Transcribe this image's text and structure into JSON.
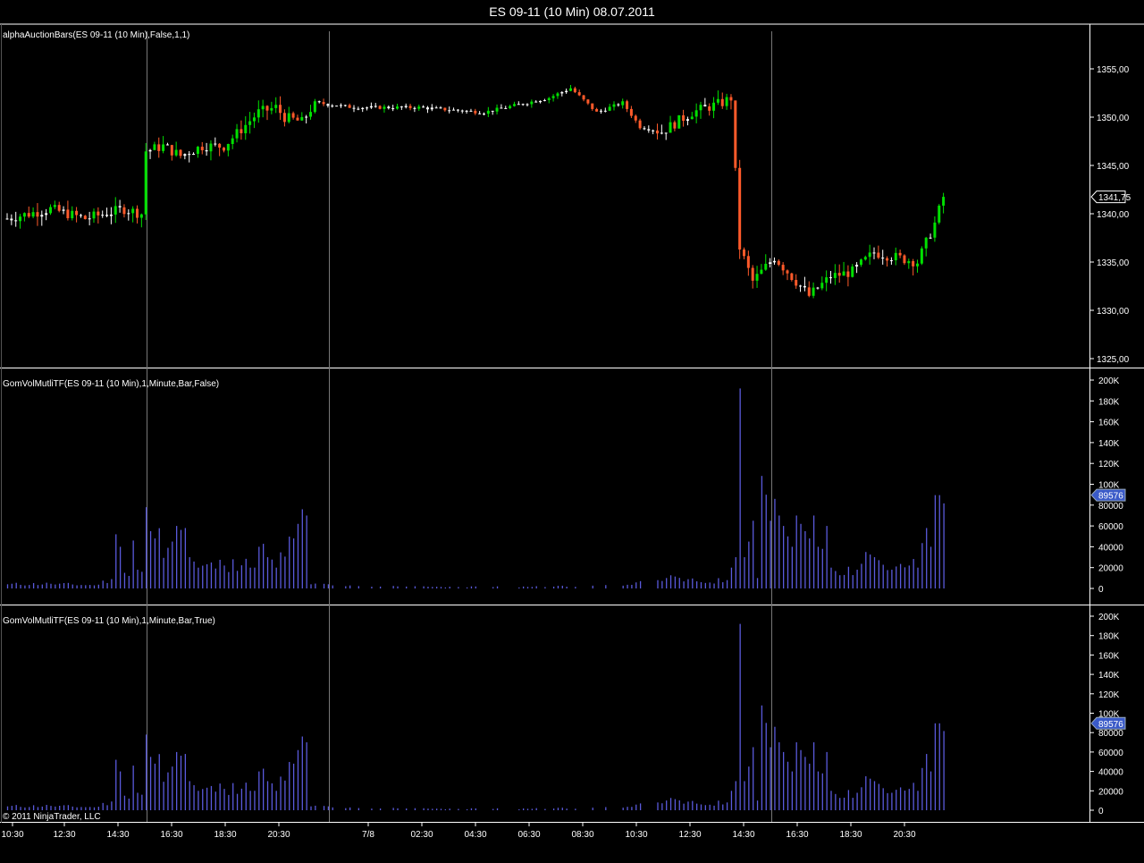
{
  "window": {
    "title": "ES 09-11 (10 Min)  08.07.2011"
  },
  "copyright": "© 2011 NinjaTrader, LLC",
  "colors": {
    "background": "#000000",
    "up_candle": "#00e000",
    "down_candle": "#ff5a2a",
    "volume_bar": "#5a5adc",
    "separator": "#ffffff",
    "session_line": "#777777",
    "price_badge": "#000000",
    "volume_badge": "#3a5ac8"
  },
  "chart_data": [
    {
      "type": "candlestick",
      "label": "alphaAuctionBars(ES 09-11 (10 Min),False,1,1)",
      "y_ticks": [
        "1325,00",
        "1330,00",
        "1335,00",
        "1340,00",
        "1345,00",
        "1350,00",
        "1355,00"
      ],
      "ylim": [
        1324,
        1359
      ],
      "last_price_label": "1341,75",
      "close_path": [
        [
          0,
          1339.5
        ],
        [
          10,
          1340.5
        ],
        [
          18,
          1339.5
        ],
        [
          27,
          1340.5
        ],
        [
          31,
          1340.0
        ],
        [
          32,
          1346.5
        ],
        [
          36,
          1347.0
        ],
        [
          40,
          1346.0
        ],
        [
          45,
          1347.0
        ],
        [
          50,
          1347.0
        ],
        [
          58,
          1350.5
        ],
        [
          62,
          1351.0
        ],
        [
          64,
          1350.0
        ],
        [
          68,
          1349.5
        ],
        [
          71,
          1351.5
        ],
        [
          80,
          1351.0
        ],
        [
          95,
          1351.0
        ],
        [
          110,
          1350.5
        ],
        [
          125,
          1352.0
        ],
        [
          130,
          1353.0
        ],
        [
          136,
          1350.5
        ],
        [
          142,
          1351.5
        ],
        [
          146,
          1349.0
        ],
        [
          151,
          1348.5
        ],
        [
          158,
          1350.5
        ],
        [
          165,
          1351.5
        ],
        [
          167,
          1352.0
        ],
        [
          169,
          1336.5
        ],
        [
          172,
          1333.0
        ],
        [
          177,
          1335.5
        ],
        [
          185,
          1331.5
        ],
        [
          190,
          1333.5
        ],
        [
          195,
          1334.0
        ],
        [
          200,
          1336.0
        ],
        [
          210,
          1335.0
        ],
        [
          214,
          1339.0
        ],
        [
          216,
          1341.75
        ]
      ]
    },
    {
      "type": "bar",
      "label": "GomVolMutliTF(ES 09-11 (10 Min),1,Minute,Bar,False)",
      "y_ticks": [
        "0",
        "20000",
        "40000",
        "60000",
        "80000",
        "100K",
        "120K",
        "140K",
        "160K",
        "180K",
        "200K"
      ],
      "ylim": [
        0,
        200000
      ],
      "last_value_label": "89576"
    },
    {
      "type": "bar",
      "label": "GomVolMutliTF(ES 09-11 (10 Min),1,Minute,Bar,True)",
      "y_ticks": [
        "0",
        "20000",
        "40000",
        "60000",
        "80000",
        "100K",
        "120K",
        "140K",
        "160K",
        "180K",
        "200K"
      ],
      "ylim": [
        0,
        200000
      ],
      "last_value_label": "89576"
    }
  ],
  "volume_series": [
    [
      0,
      4000
    ],
    [
      10,
      4500
    ],
    [
      20,
      3000
    ],
    [
      24,
      9000
    ],
    [
      25,
      52000
    ],
    [
      26,
      40000
    ],
    [
      27,
      15000
    ],
    [
      28,
      12000
    ],
    [
      29,
      46000
    ],
    [
      30,
      18000
    ],
    [
      31,
      16000
    ],
    [
      32,
      78000
    ],
    [
      33,
      55000
    ],
    [
      34,
      48000
    ],
    [
      38,
      45000
    ],
    [
      39,
      60000
    ],
    [
      41,
      58000
    ],
    [
      42,
      30000
    ],
    [
      44,
      20000
    ],
    [
      50,
      22000
    ],
    [
      52,
      28000
    ],
    [
      56,
      20000
    ],
    [
      58,
      40000
    ],
    [
      60,
      30000
    ],
    [
      62,
      20000
    ],
    [
      66,
      48000
    ],
    [
      67,
      62000
    ],
    [
      68,
      76000
    ],
    [
      69,
      70000
    ],
    [
      70,
      4000
    ],
    [
      80,
      2000
    ],
    [
      100,
      1500
    ],
    [
      120,
      1500
    ],
    [
      140,
      3000
    ],
    [
      150,
      8000
    ],
    [
      152,
      10000
    ],
    [
      160,
      6000
    ],
    [
      166,
      8000
    ],
    [
      167,
      20000
    ],
    [
      168,
      30000
    ],
    [
      169,
      192000
    ],
    [
      170,
      30000
    ],
    [
      171,
      45000
    ],
    [
      172,
      65000
    ],
    [
      173,
      10000
    ],
    [
      174,
      108000
    ],
    [
      175,
      90000
    ],
    [
      176,
      65000
    ],
    [
      177,
      86000
    ],
    [
      178,
      70000
    ],
    [
      179,
      60000
    ],
    [
      180,
      50000
    ],
    [
      181,
      40000
    ],
    [
      182,
      70000
    ],
    [
      183,
      62000
    ],
    [
      184,
      55000
    ],
    [
      185,
      48000
    ],
    [
      186,
      70000
    ],
    [
      187,
      40000
    ],
    [
      188,
      38000
    ],
    [
      189,
      60000
    ],
    [
      190,
      20000
    ],
    [
      196,
      18000
    ],
    [
      198,
      35000
    ],
    [
      200,
      30000
    ],
    [
      204,
      18000
    ],
    [
      208,
      22000
    ],
    [
      210,
      20000
    ],
    [
      212,
      58000
    ],
    [
      213,
      40000
    ],
    [
      214,
      89576
    ],
    [
      215,
      89576
    ]
  ],
  "x_axis_labels": [
    "10:30",
    "12:30",
    "14:30",
    "16:30",
    "18:30",
    "20:30",
    "7/8",
    "02:30",
    "04:30",
    "06:30",
    "08:30",
    "10:30",
    "12:30",
    "14:30",
    "16:30",
    "18:30",
    "20:30"
  ]
}
